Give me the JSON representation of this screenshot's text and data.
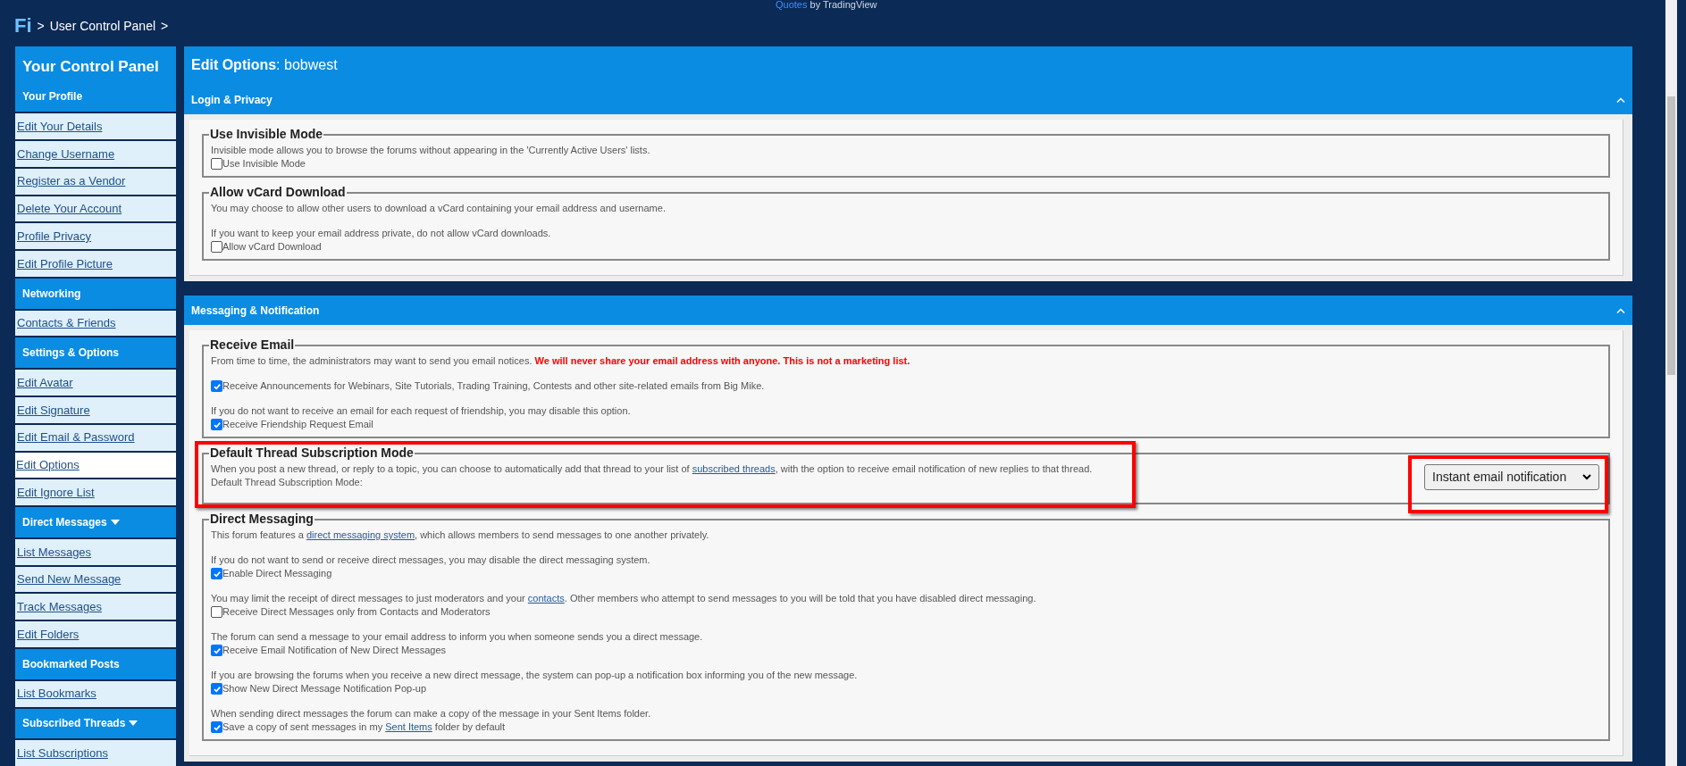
{
  "top_credit": {
    "link": "Quotes",
    "text": "by TradingView"
  },
  "breadcrumb": {
    "logo": "Fi",
    "separator": ">",
    "items": [
      "User Control Panel"
    ]
  },
  "sidebar": {
    "title": "Your Control Panel",
    "sections": [
      {
        "title": "Your Profile",
        "has_menu": false,
        "items": [
          {
            "label": "Edit Your Details",
            "selected": false
          },
          {
            "label": "Change Username",
            "selected": false
          },
          {
            "label": "Register as a Vendor",
            "selected": false
          },
          {
            "label": "Delete Your Account",
            "selected": false
          },
          {
            "label": "Profile Privacy",
            "selected": false
          },
          {
            "label": "Edit Profile Picture",
            "selected": false
          }
        ]
      },
      {
        "title": "Networking",
        "has_menu": false,
        "items": [
          {
            "label": "Contacts & Friends",
            "selected": false
          }
        ]
      },
      {
        "title": "Settings & Options",
        "has_menu": false,
        "items": [
          {
            "label": "Edit Avatar",
            "selected": false
          },
          {
            "label": "Edit Signature",
            "selected": false
          },
          {
            "label": "Edit Email & Password",
            "selected": false
          },
          {
            "label": "Edit Options",
            "selected": true
          },
          {
            "label": "Edit Ignore List",
            "selected": false
          }
        ]
      },
      {
        "title": "Direct Messages",
        "has_menu": true,
        "items": [
          {
            "label": "List Messages",
            "selected": false
          },
          {
            "label": "Send New Message",
            "selected": false
          },
          {
            "label": "Track Messages",
            "selected": false
          },
          {
            "label": "Edit Folders",
            "selected": false
          }
        ]
      },
      {
        "title": "Bookmarked Posts",
        "has_menu": false,
        "items": [
          {
            "label": "List Bookmarks",
            "selected": false
          }
        ]
      },
      {
        "title": "Subscribed Threads",
        "has_menu": true,
        "items": [
          {
            "label": "List Subscriptions",
            "selected": false
          }
        ]
      }
    ]
  },
  "main": {
    "title": "Edit Options",
    "separator": ":",
    "username": "bobwest",
    "panels": [
      {
        "title": "Login & Privacy",
        "expanded": true,
        "fieldsets": [
          {
            "legend": "Use Invisible Mode",
            "highlighted": false,
            "rows": [
              {
                "kind": "text",
                "segments": [
                  {
                    "kind": "plain",
                    "text": "Invisible mode allows you to browse the forums without appearing in the 'Currently Active Users' lists."
                  }
                ]
              },
              {
                "kind": "checkbox",
                "checked": false,
                "segments": [
                  {
                    "kind": "plain",
                    "text": "Use Invisible Mode"
                  }
                ]
              }
            ]
          },
          {
            "legend": "Allow vCard Download",
            "highlighted": false,
            "rows": [
              {
                "kind": "text",
                "segments": [
                  {
                    "kind": "plain",
                    "text": "You may choose to allow other users to download a vCard containing your email address and username."
                  }
                ]
              },
              {
                "kind": "gap"
              },
              {
                "kind": "text",
                "segments": [
                  {
                    "kind": "plain",
                    "text": "If you want to keep your email address private, do not allow vCard downloads."
                  }
                ]
              },
              {
                "kind": "checkbox",
                "checked": false,
                "segments": [
                  {
                    "kind": "plain",
                    "text": "Allow vCard Download"
                  }
                ]
              }
            ]
          }
        ]
      },
      {
        "title": "Messaging & Notification",
        "expanded": true,
        "fieldsets": [
          {
            "legend": "Receive Email",
            "highlighted": false,
            "rows": [
              {
                "kind": "text",
                "segments": [
                  {
                    "kind": "plain",
                    "text": "From time to time, the administrators may want to send you email notices. "
                  },
                  {
                    "kind": "alert",
                    "text": "We will never share your email address with anyone. This is not a marketing list."
                  }
                ]
              },
              {
                "kind": "gap"
              },
              {
                "kind": "checkbox",
                "checked": true,
                "segments": [
                  {
                    "kind": "plain",
                    "text": "Receive Announcements for Webinars, Site Tutorials, Trading Training, Contests and other site-related emails from Big Mike."
                  }
                ]
              },
              {
                "kind": "gap"
              },
              {
                "kind": "text",
                "segments": [
                  {
                    "kind": "plain",
                    "text": "If you do not want to receive an email for each request of friendship, you may disable this option."
                  }
                ]
              },
              {
                "kind": "checkbox",
                "checked": true,
                "segments": [
                  {
                    "kind": "plain",
                    "text": "Receive Friendship Request Email"
                  }
                ]
              }
            ]
          },
          {
            "legend": "Default Thread Subscription Mode",
            "highlighted": true,
            "rows": [
              {
                "kind": "text",
                "segments": [
                  {
                    "kind": "plain",
                    "text": "When you post a new thread, or reply to a topic, you can choose to automatically add that thread to your list of "
                  },
                  {
                    "kind": "link",
                    "text": "subscribed threads"
                  },
                  {
                    "kind": "plain",
                    "text": ", with the option to receive email notification of new replies to that thread."
                  }
                ]
              },
              {
                "kind": "text",
                "segments": [
                  {
                    "kind": "plain",
                    "text": "Default Thread Subscription Mode:"
                  }
                ]
              }
            ],
            "select": {
              "value": "Instant email notification",
              "highlighted": true
            }
          },
          {
            "legend": "Direct Messaging",
            "highlighted": false,
            "rows": [
              {
                "kind": "text",
                "segments": [
                  {
                    "kind": "plain",
                    "text": "This forum features a "
                  },
                  {
                    "kind": "link",
                    "text": "direct messaging system"
                  },
                  {
                    "kind": "plain",
                    "text": ", which allows members to send messages to one another privately."
                  }
                ]
              },
              {
                "kind": "gap"
              },
              {
                "kind": "text",
                "segments": [
                  {
                    "kind": "plain",
                    "text": "If you do not want to send or receive direct messages, you may disable the direct messaging system."
                  }
                ]
              },
              {
                "kind": "checkbox",
                "checked": true,
                "segments": [
                  {
                    "kind": "plain",
                    "text": "Enable Direct Messaging"
                  }
                ]
              },
              {
                "kind": "gap"
              },
              {
                "kind": "text",
                "segments": [
                  {
                    "kind": "plain",
                    "text": "You may limit the receipt of direct messages to just moderators and your "
                  },
                  {
                    "kind": "link",
                    "text": "contacts"
                  },
                  {
                    "kind": "plain",
                    "text": ". Other members who attempt to send messages to you will be told that you have disabled direct messaging."
                  }
                ]
              },
              {
                "kind": "checkbox",
                "checked": false,
                "segments": [
                  {
                    "kind": "plain",
                    "text": "Receive Direct Messages only from Contacts and Moderators"
                  }
                ]
              },
              {
                "kind": "gap"
              },
              {
                "kind": "text",
                "segments": [
                  {
                    "kind": "plain",
                    "text": "The forum can send a message to your email address to inform you when someone sends you a direct message."
                  }
                ]
              },
              {
                "kind": "checkbox",
                "checked": true,
                "segments": [
                  {
                    "kind": "plain",
                    "text": "Receive Email Notification of New Direct Messages"
                  }
                ]
              },
              {
                "kind": "gap"
              },
              {
                "kind": "text",
                "segments": [
                  {
                    "kind": "plain",
                    "text": "If you are browsing the forums when you receive a new direct message, the system can pop-up a notification box informing you of the new message."
                  }
                ]
              },
              {
                "kind": "checkbox",
                "checked": true,
                "segments": [
                  {
                    "kind": "plain",
                    "text": "Show New Direct Message Notification Pop-up"
                  }
                ]
              },
              {
                "kind": "gap"
              },
              {
                "kind": "text",
                "segments": [
                  {
                    "kind": "plain",
                    "text": "When sending direct messages the forum can make a copy of the message in your Sent Items folder."
                  }
                ]
              },
              {
                "kind": "checkbox",
                "checked": true,
                "segments": [
                  {
                    "kind": "plain",
                    "text": "Save a copy of sent messages in my "
                  },
                  {
                    "kind": "link",
                    "text": "Sent Items"
                  },
                  {
                    "kind": "plain",
                    "text": " folder by default"
                  }
                ]
              }
            ]
          }
        ]
      }
    ]
  }
}
